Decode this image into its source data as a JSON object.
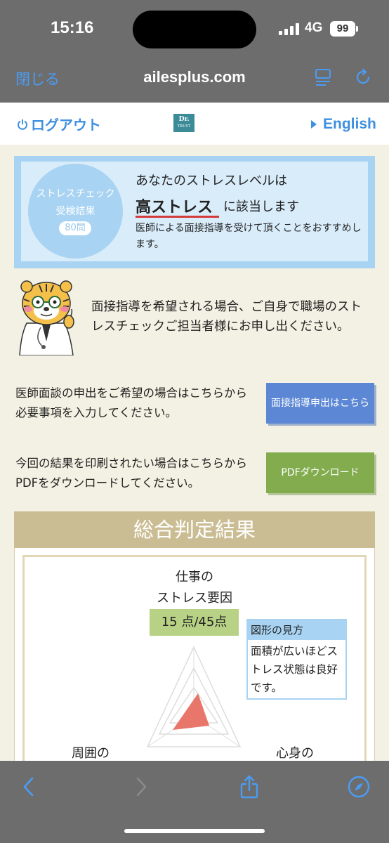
{
  "status_bar": {
    "time": "15:16",
    "network": "4G",
    "battery": "99"
  },
  "browser": {
    "close_label": "閉じる",
    "url": "ailesplus.com"
  },
  "header": {
    "logout_label": "ログアウト",
    "logo_line1": "Dr.",
    "logo_line2": "TRUST",
    "english_label": "English"
  },
  "result": {
    "badge_line1": "ストレスチェック",
    "badge_line2": "受検結果",
    "badge_count": "80問",
    "line1": "あなたのストレスレベルは",
    "level": "高ストレス",
    "level_suffix": "に該当します",
    "advice": "医師による面接指導を受けて頂くことをおすすめします。"
  },
  "message": "面接指導を希望される場合、ご自身で職場のストレスチェックご担当者様にお申し出ください。",
  "interview": {
    "text": "医師面談の申出をご希望の場合はこちらから必要事項を入力してください。",
    "button": "面接指導申出はこちら"
  },
  "pdf": {
    "text": "今回の結果を印刷されたい場合はこちらからPDFをダウンロードしてください。",
    "button": "PDFダウンロード"
  },
  "overall": {
    "title": "総合判定結果",
    "axis_top_line1": "仕事の",
    "axis_top_line2": "ストレス要因",
    "score": "15 点/45点",
    "legend_title": "図形の見方",
    "legend_text": "面積が広いほどストレス状態は良好です。",
    "axis_left": "周囲の",
    "axis_right": "心身の"
  },
  "colors": {
    "accent": "#4b9cf5",
    "high_stress_underline": "#d43c3c",
    "radar_fill": "#e8766a"
  }
}
